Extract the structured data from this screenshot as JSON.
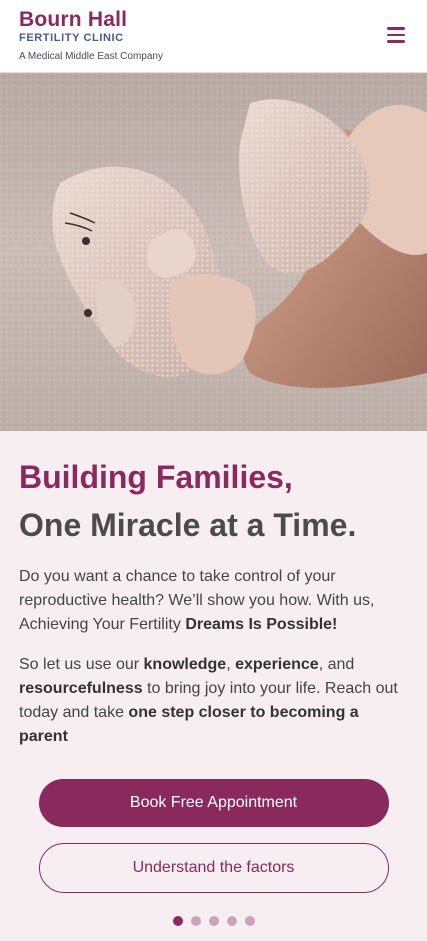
{
  "header": {
    "brand_line1": "Bourn Hall",
    "brand_line2": "FERTILITY CLINIC",
    "brand_tagline": "A Medical Middle East Company",
    "menu_icon": "hamburger-menu-icon"
  },
  "hero": {
    "image_alt": ""
  },
  "main": {
    "heading_line1": "Building Families,",
    "heading_line2": "One Miracle at a Time.",
    "para1": {
      "text": "Do you want a chance to take control of your reproductive health? We’ll show you how. With us, Achieving Your Fertility ",
      "bold": "Dreams Is Possible!"
    },
    "para2": {
      "t1": "So let us use our ",
      "b1": "knowledge",
      "t2": ", ",
      "b2": "experience",
      "t3": ", and ",
      "b3": "resourcefulness",
      "t4": " to bring joy into your life. Reach out today and take ",
      "b4": "one step closer to becoming a parent"
    },
    "primary_button": "Book Free Appointment",
    "secondary_button": "Understand the factors"
  },
  "carousel": {
    "slide_count": 5,
    "active_index": 0
  },
  "colors": {
    "brand": "#8a2a5c",
    "brand_secondary": "#4a5a8c",
    "background": "#f6eef1"
  }
}
